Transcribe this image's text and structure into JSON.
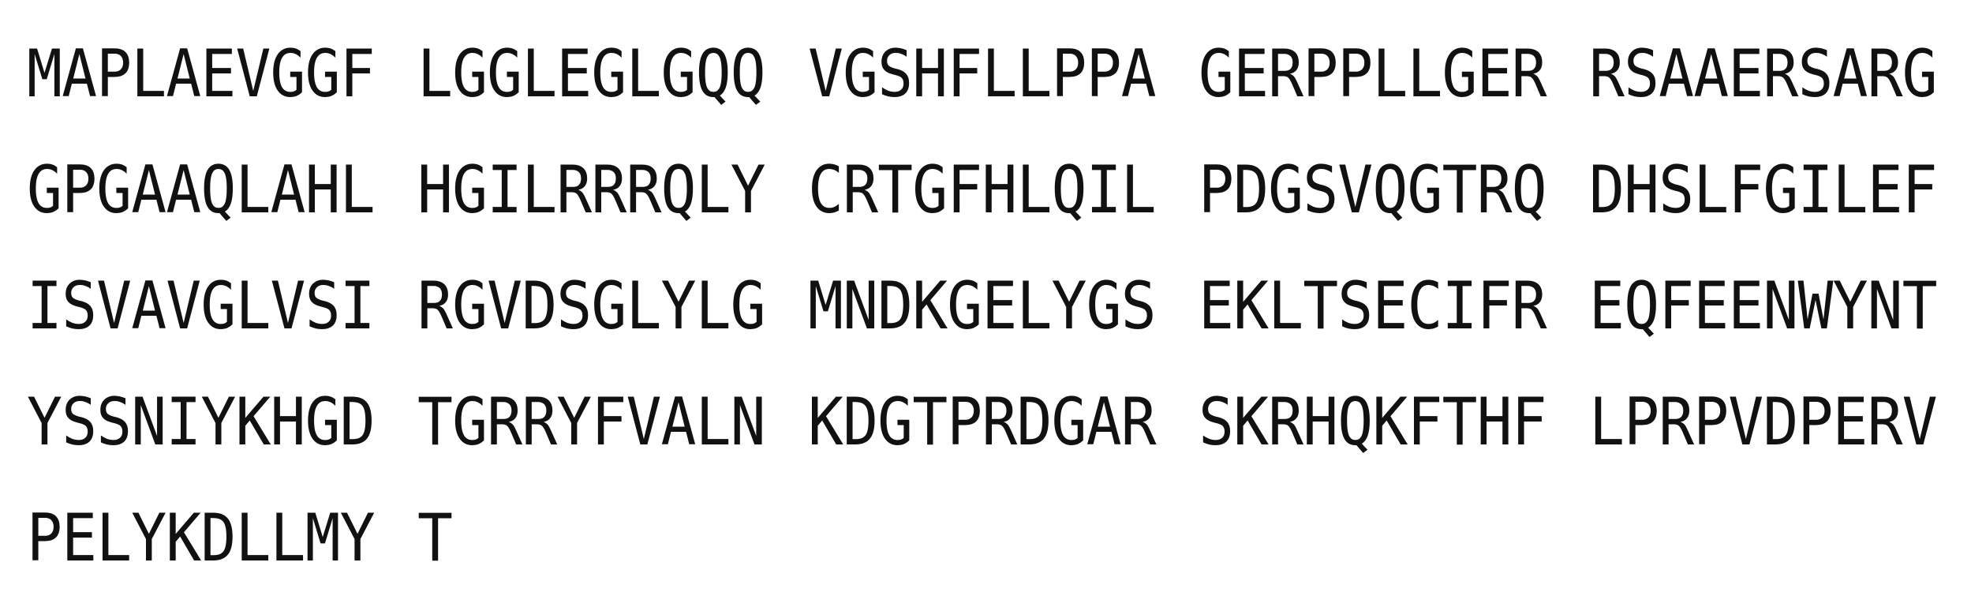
{
  "sequence": {
    "rows": [
      [
        "MAPLAEVGGF",
        "LGGLEGLGQQ",
        "VGSHFLLPPA",
        "GERPPLLGER",
        "RSAAERSARG"
      ],
      [
        "GPGAAQLAHL",
        "HGILRRRQLY",
        "CRTGFHLQIL",
        "PDGSVQGTRQ",
        "DHSLFGILEF"
      ],
      [
        "ISVAVGLVSI",
        "RGVDSGLYLG",
        "MNDKGELYGS",
        "EKLTSECIFR",
        "EQFEENWYNT"
      ],
      [
        "YSSNIYKHGD",
        "TGRRYFVALN",
        "KDGTPRDGAR",
        "SKRHQKFTHF",
        "LPRPVDPERV"
      ],
      [
        "PELYKDLLMY",
        "T"
      ]
    ]
  }
}
